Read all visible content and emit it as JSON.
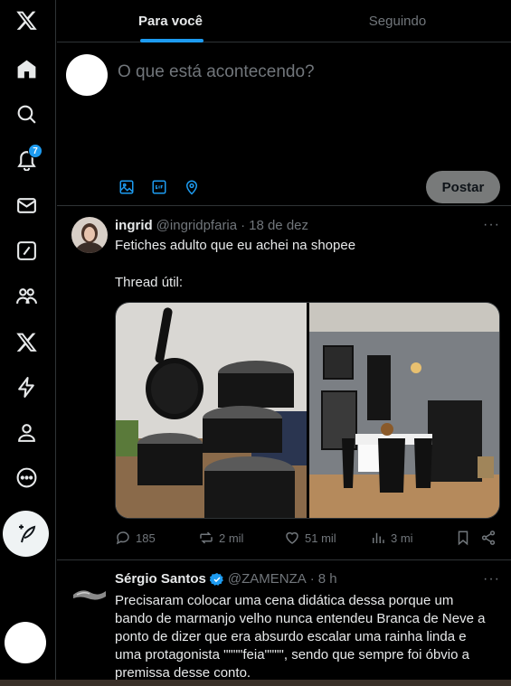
{
  "colors": {
    "accent": "#1d9bf0",
    "background": "#000000",
    "muted": "#71767b",
    "text": "#e7e9ea",
    "border": "#2f3336"
  },
  "sidebar": {
    "items": [
      {
        "icon": "x-logo-icon"
      },
      {
        "icon": "home-icon"
      },
      {
        "icon": "search-icon"
      },
      {
        "icon": "notifications-icon",
        "badge": "7"
      },
      {
        "icon": "messages-icon"
      },
      {
        "icon": "grok-icon"
      },
      {
        "icon": "communities-icon"
      },
      {
        "icon": "premium-icon"
      },
      {
        "icon": "lightning-icon"
      },
      {
        "icon": "profile-icon"
      },
      {
        "icon": "more-icon"
      }
    ],
    "compose_icon": "feather-plus-icon"
  },
  "tabs": [
    {
      "label": "Para você",
      "active": true
    },
    {
      "label": "Seguindo",
      "active": false
    }
  ],
  "composer": {
    "placeholder": "O que está acontecendo?",
    "tools": [
      "image-icon",
      "gif-icon",
      "location-icon"
    ],
    "post_label": "Postar"
  },
  "tweets": [
    {
      "name": "ingrid",
      "handle": "@ingridpfaria",
      "dot": "·",
      "time": "18 de dez",
      "more": "···",
      "text_line1": "Fetiches adulto que eu achei na shopee",
      "text_line2": "Thread útil:",
      "media_left": "black cookware set",
      "media_right": "black dining room",
      "stats": {
        "replies": "185",
        "retweets": "2 mil",
        "likes": "51 mil",
        "views": "3 mi"
      }
    },
    {
      "name": "Sérgio Santos",
      "handle": "@ZAMENZA",
      "dot": "·",
      "time": "8 h",
      "more": "···",
      "verified": true,
      "text": "Precisaram colocar uma cena didática dessa porque um bando de marmanjo velho nunca entendeu Branca de Neve a ponto de dizer que era absurdo escalar uma rainha linda e uma protagonista \"\"\"\"feia\"\"\"\", sendo que sempre foi óbvio a premissa desse conto."
    }
  ]
}
